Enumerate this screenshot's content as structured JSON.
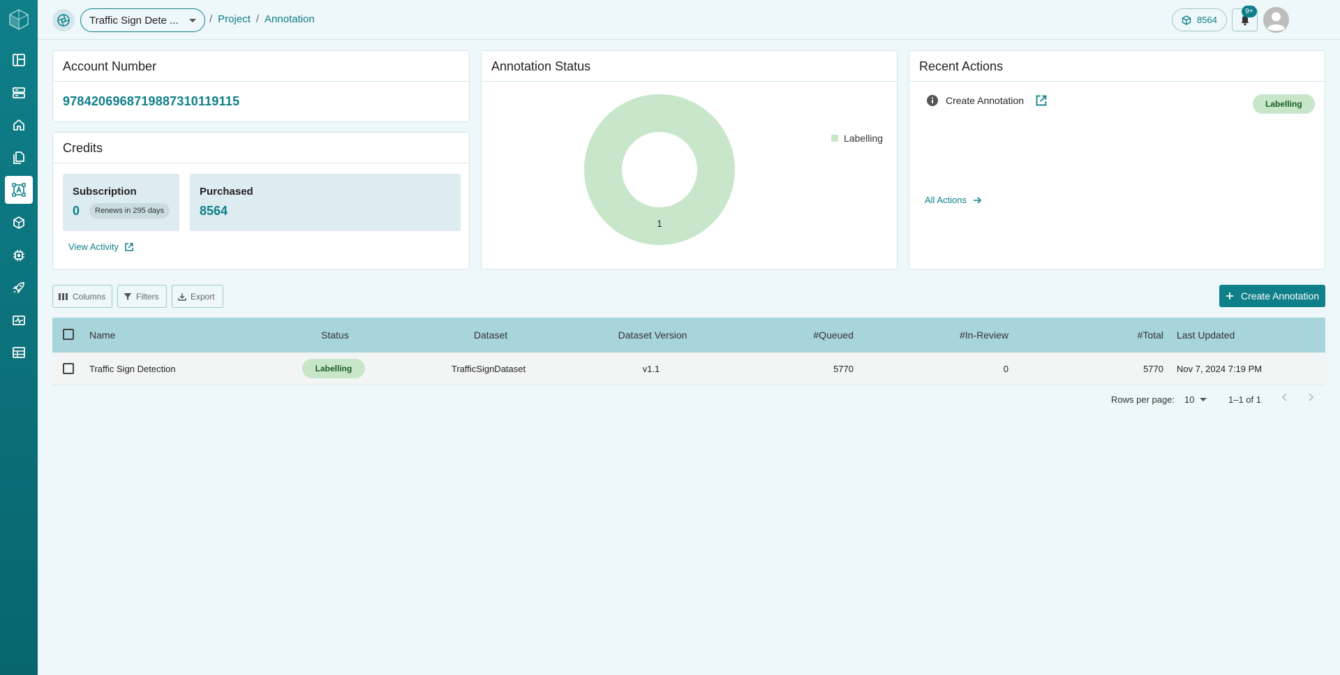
{
  "topbar": {
    "project_name": "Traffic Sign Dete ...",
    "breadcrumb_sep": "/",
    "breadcrumb_project": "Project",
    "breadcrumb_annotation": "Annotation",
    "credits": "8564",
    "notification_badge": "9+"
  },
  "sidebar": {
    "items": [
      "dashboard-icon",
      "layers-icon",
      "home-icon",
      "files-icon",
      "annotation-icon",
      "model-icon",
      "chip-icon",
      "rocket-icon",
      "monitor-icon",
      "table-icon"
    ],
    "active_index": 4
  },
  "account": {
    "title": "Account Number",
    "number": "9784206968719887310119115"
  },
  "credits_card": {
    "title": "Credits",
    "subscription_label": "Subscription",
    "subscription_value": "0",
    "renews": "Renews in 295 days",
    "purchased_label": "Purchased",
    "purchased_value": "8564",
    "view_activity": "View Activity"
  },
  "annotation_status": {
    "title": "Annotation Status",
    "legend": "Labelling",
    "slice_label": "1"
  },
  "recent_actions": {
    "title": "Recent Actions",
    "action": "Create Annotation",
    "status": "Labelling",
    "all_actions": "All Actions"
  },
  "toolbar": {
    "columns": "Columns",
    "filters": "Filters",
    "export": "Export",
    "create": "Create Annotation"
  },
  "table": {
    "headers": {
      "name": "Name",
      "status": "Status",
      "dataset": "Dataset",
      "dataset_version": "Dataset Version",
      "queued": "#Queued",
      "in_review": "#In-Review",
      "total": "#Total",
      "last_updated": "Last Updated"
    },
    "rows": [
      {
        "name": "Traffic Sign Detection",
        "status": "Labelling",
        "dataset": "TrafficSignDataset",
        "dataset_version": "v1.1",
        "queued": "5770",
        "in_review": "0",
        "total": "5770",
        "last_updated": "Nov 7, 2024 7:19 PM"
      }
    ]
  },
  "pagination": {
    "rows_per_page_label": "Rows per page:",
    "rows_per_page": "10",
    "range": "1–1 of 1"
  },
  "colors": {
    "accent": "#0f7f89",
    "labelling_chip": "#c8e6c9",
    "table_header": "#a8d5db"
  }
}
